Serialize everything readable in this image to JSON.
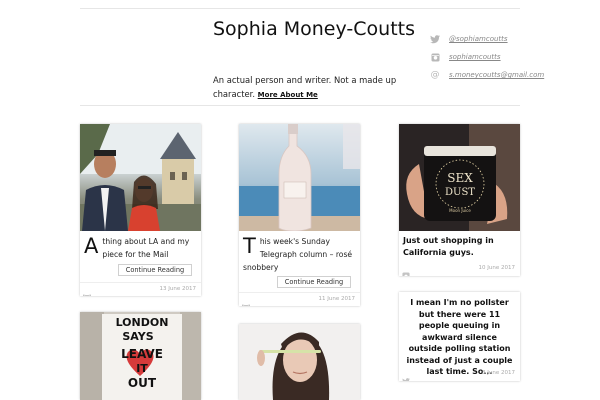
{
  "header": {
    "title": "Sophia Money-Coutts",
    "tagline": "An actual person and writer. Not a made up character.",
    "more_link": "More About Me"
  },
  "social": [
    {
      "icon": "twitter-icon",
      "label": "@sophiamcoutts"
    },
    {
      "icon": "instagram-icon",
      "label": "sophiamcoutts"
    },
    {
      "icon": "at-icon",
      "label": "s.moneycoutts@gmail.com"
    }
  ],
  "posts": [
    {
      "dropcap": "A",
      "excerpt": "thing about LA and my piece for the Mail",
      "button": "Continue Reading",
      "date": "13 June 2017",
      "icon": "book-icon"
    },
    {
      "dropcap": "T",
      "excerpt": "his week's Sunday Telegraph column – rosé snobbery",
      "button": "Continue Reading",
      "date": "11 June 2017",
      "icon": "book-icon"
    },
    {
      "text": "Just out shopping in California guys.",
      "date": "10 June 2017",
      "icon": "instagram-icon",
      "jar_label_1": "SEX",
      "jar_label_2": "DUST",
      "jar_sub": "Moon Juice"
    },
    {
      "quote": "I mean I'm no pollster but there were 11 people queuing in awkward silence outside polling station instead of just a couple last time. So...",
      "date": "8 June 2017",
      "icon": "twitter-icon"
    },
    {
      "sign_lines": [
        "LONDON",
        "SAYS",
        "LEAVE",
        "IT",
        "OUT"
      ]
    },
    {}
  ],
  "colors": {
    "rule": "#e6e6e6",
    "muted": "#aaaaaa",
    "heart": "#d63a3a"
  }
}
